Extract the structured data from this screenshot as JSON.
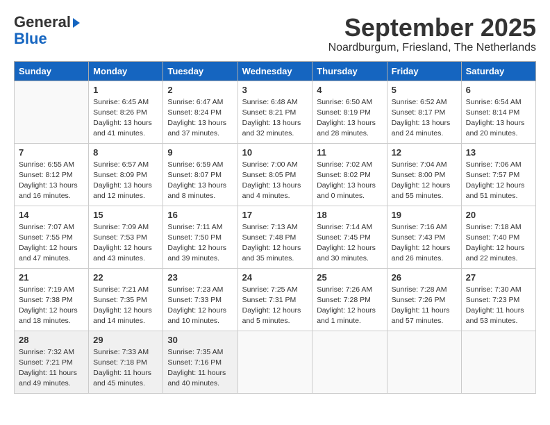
{
  "header": {
    "logo_line1": "General",
    "logo_line2": "Blue",
    "month": "September 2025",
    "location": "Noardburgum, Friesland, The Netherlands"
  },
  "days_of_week": [
    "Sunday",
    "Monday",
    "Tuesday",
    "Wednesday",
    "Thursday",
    "Friday",
    "Saturday"
  ],
  "weeks": [
    [
      {
        "num": "",
        "info": ""
      },
      {
        "num": "1",
        "info": "Sunrise: 6:45 AM\nSunset: 8:26 PM\nDaylight: 13 hours\nand 41 minutes."
      },
      {
        "num": "2",
        "info": "Sunrise: 6:47 AM\nSunset: 8:24 PM\nDaylight: 13 hours\nand 37 minutes."
      },
      {
        "num": "3",
        "info": "Sunrise: 6:48 AM\nSunset: 8:21 PM\nDaylight: 13 hours\nand 32 minutes."
      },
      {
        "num": "4",
        "info": "Sunrise: 6:50 AM\nSunset: 8:19 PM\nDaylight: 13 hours\nand 28 minutes."
      },
      {
        "num": "5",
        "info": "Sunrise: 6:52 AM\nSunset: 8:17 PM\nDaylight: 13 hours\nand 24 minutes."
      },
      {
        "num": "6",
        "info": "Sunrise: 6:54 AM\nSunset: 8:14 PM\nDaylight: 13 hours\nand 20 minutes."
      }
    ],
    [
      {
        "num": "7",
        "info": "Sunrise: 6:55 AM\nSunset: 8:12 PM\nDaylight: 13 hours\nand 16 minutes."
      },
      {
        "num": "8",
        "info": "Sunrise: 6:57 AM\nSunset: 8:09 PM\nDaylight: 13 hours\nand 12 minutes."
      },
      {
        "num": "9",
        "info": "Sunrise: 6:59 AM\nSunset: 8:07 PM\nDaylight: 13 hours\nand 8 minutes."
      },
      {
        "num": "10",
        "info": "Sunrise: 7:00 AM\nSunset: 8:05 PM\nDaylight: 13 hours\nand 4 minutes."
      },
      {
        "num": "11",
        "info": "Sunrise: 7:02 AM\nSunset: 8:02 PM\nDaylight: 13 hours\nand 0 minutes."
      },
      {
        "num": "12",
        "info": "Sunrise: 7:04 AM\nSunset: 8:00 PM\nDaylight: 12 hours\nand 55 minutes."
      },
      {
        "num": "13",
        "info": "Sunrise: 7:06 AM\nSunset: 7:57 PM\nDaylight: 12 hours\nand 51 minutes."
      }
    ],
    [
      {
        "num": "14",
        "info": "Sunrise: 7:07 AM\nSunset: 7:55 PM\nDaylight: 12 hours\nand 47 minutes."
      },
      {
        "num": "15",
        "info": "Sunrise: 7:09 AM\nSunset: 7:53 PM\nDaylight: 12 hours\nand 43 minutes."
      },
      {
        "num": "16",
        "info": "Sunrise: 7:11 AM\nSunset: 7:50 PM\nDaylight: 12 hours\nand 39 minutes."
      },
      {
        "num": "17",
        "info": "Sunrise: 7:13 AM\nSunset: 7:48 PM\nDaylight: 12 hours\nand 35 minutes."
      },
      {
        "num": "18",
        "info": "Sunrise: 7:14 AM\nSunset: 7:45 PM\nDaylight: 12 hours\nand 30 minutes."
      },
      {
        "num": "19",
        "info": "Sunrise: 7:16 AM\nSunset: 7:43 PM\nDaylight: 12 hours\nand 26 minutes."
      },
      {
        "num": "20",
        "info": "Sunrise: 7:18 AM\nSunset: 7:40 PM\nDaylight: 12 hours\nand 22 minutes."
      }
    ],
    [
      {
        "num": "21",
        "info": "Sunrise: 7:19 AM\nSunset: 7:38 PM\nDaylight: 12 hours\nand 18 minutes."
      },
      {
        "num": "22",
        "info": "Sunrise: 7:21 AM\nSunset: 7:35 PM\nDaylight: 12 hours\nand 14 minutes."
      },
      {
        "num": "23",
        "info": "Sunrise: 7:23 AM\nSunset: 7:33 PM\nDaylight: 12 hours\nand 10 minutes."
      },
      {
        "num": "24",
        "info": "Sunrise: 7:25 AM\nSunset: 7:31 PM\nDaylight: 12 hours\nand 5 minutes."
      },
      {
        "num": "25",
        "info": "Sunrise: 7:26 AM\nSunset: 7:28 PM\nDaylight: 12 hours\nand 1 minute."
      },
      {
        "num": "26",
        "info": "Sunrise: 7:28 AM\nSunset: 7:26 PM\nDaylight: 11 hours\nand 57 minutes."
      },
      {
        "num": "27",
        "info": "Sunrise: 7:30 AM\nSunset: 7:23 PM\nDaylight: 11 hours\nand 53 minutes."
      }
    ],
    [
      {
        "num": "28",
        "info": "Sunrise: 7:32 AM\nSunset: 7:21 PM\nDaylight: 11 hours\nand 49 minutes."
      },
      {
        "num": "29",
        "info": "Sunrise: 7:33 AM\nSunset: 7:18 PM\nDaylight: 11 hours\nand 45 minutes."
      },
      {
        "num": "30",
        "info": "Sunrise: 7:35 AM\nSunset: 7:16 PM\nDaylight: 11 hours\nand 40 minutes."
      },
      {
        "num": "",
        "info": ""
      },
      {
        "num": "",
        "info": ""
      },
      {
        "num": "",
        "info": ""
      },
      {
        "num": "",
        "info": ""
      }
    ]
  ]
}
